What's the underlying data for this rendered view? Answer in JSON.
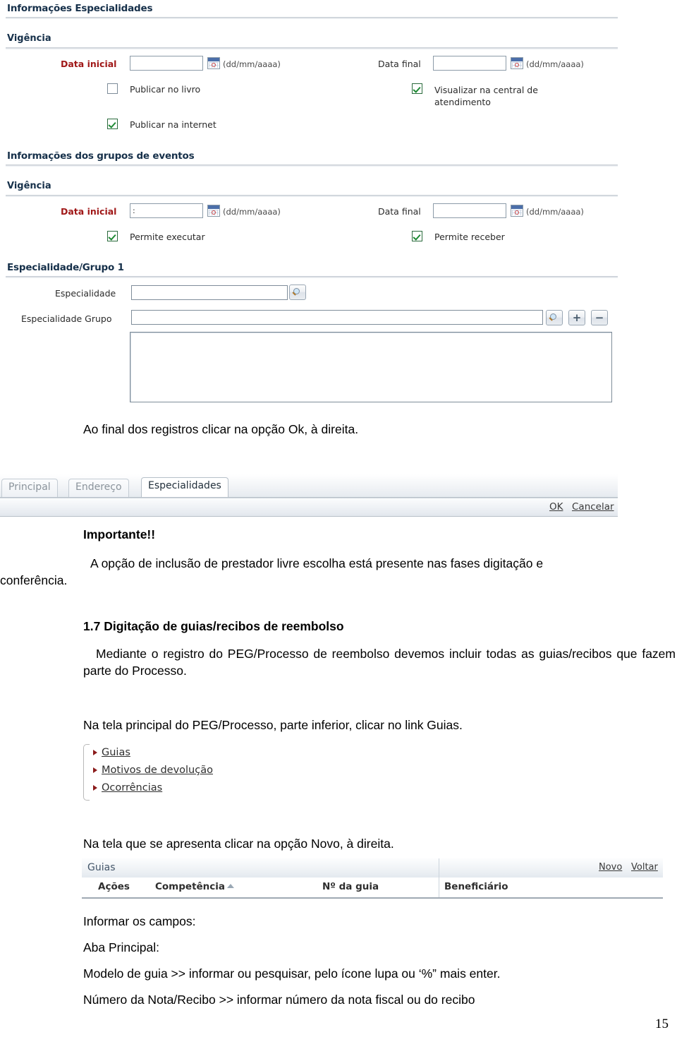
{
  "form_especialidades": {
    "section1_title": "Informações Especialidades",
    "section1_sub": "Vigência",
    "data_inicial_label": "Data inicial",
    "data_inicial_value": "",
    "data_final_label": "Data final",
    "data_final_value": "",
    "date_hint": "(dd/mm/aaaa)",
    "publicar_livro": "Publicar no livro",
    "publicar_internet": "Publicar na internet",
    "visualizar_central": "Visualizar na central de atendimento",
    "section2_title": "Informações dos grupos de eventos",
    "section2_sub": "Vigência",
    "data_inicial2_label": "Data inicial",
    "data_inicial2_value": ":",
    "data_final2_label": "Data final",
    "data_final2_value": "",
    "permite_executar": "Permite executar",
    "permite_receber": "Permite receber",
    "section3_title": "Especialidade/Grupo 1",
    "especialidade_label": "Especialidade",
    "especialidade_value": "",
    "especialidade_grupo_label": "Especialidade Grupo",
    "especialidade_grupo_value": "",
    "lista_value": ""
  },
  "text_ok_instruction": "Ao final dos registros clicar na opção Ok, à direita.",
  "tabs_shot": {
    "tabs": [
      {
        "label": "Principal",
        "active": false
      },
      {
        "label": "Endereço",
        "active": false
      },
      {
        "label": "Especialidades",
        "active": true
      }
    ],
    "ok_label": "OK",
    "cancel_label": "Cancelar"
  },
  "importante": {
    "heading": "Importante!!",
    "line1": "A opção de inclusão de prestador livre escolha está presente nas fases digitação e",
    "line2": "conferência."
  },
  "section_17": {
    "heading": "1.7 Digitação de guias/recibos de reembolso",
    "paragraph": "Mediante o registro do PEG/Processo de reembolso devemos incluir todas as guias/recibos que fazem parte do Processo."
  },
  "text_link_guias": "Na tela principal do PEG/Processo, parte inferior, clicar no link Guias.",
  "tree_shot": {
    "items": [
      "Guias",
      "Motivos de devolução",
      "Ocorrências"
    ]
  },
  "text_novo_instruction": "Na tela que se apresenta clicar na opção Novo, à direita.",
  "grid_shot": {
    "title": "Guias",
    "novo_label": "Novo",
    "voltar_label": "Voltar",
    "columns": [
      "Ações",
      "Competência",
      "Nº da guia",
      "Beneficiário"
    ],
    "sorted_column": "Competência",
    "sort_direction": "asc"
  },
  "footer_lines": {
    "l1": "Informar os campos:",
    "l2": "Aba Principal:",
    "l3": "Modelo de guia >> informar ou pesquisar, pelo ícone lupa ou ‘%” mais enter.",
    "l4": "Número da Nota/Recibo >> informar número da nota fiscal ou do recibo"
  },
  "page_number": "15",
  "colors": {
    "required_label": "#a01818",
    "section_heading": "#16304a",
    "rule": "#c9cfd6",
    "checkbox_check": "#1e8a34",
    "tree_bullet": "#8b1b1b"
  }
}
